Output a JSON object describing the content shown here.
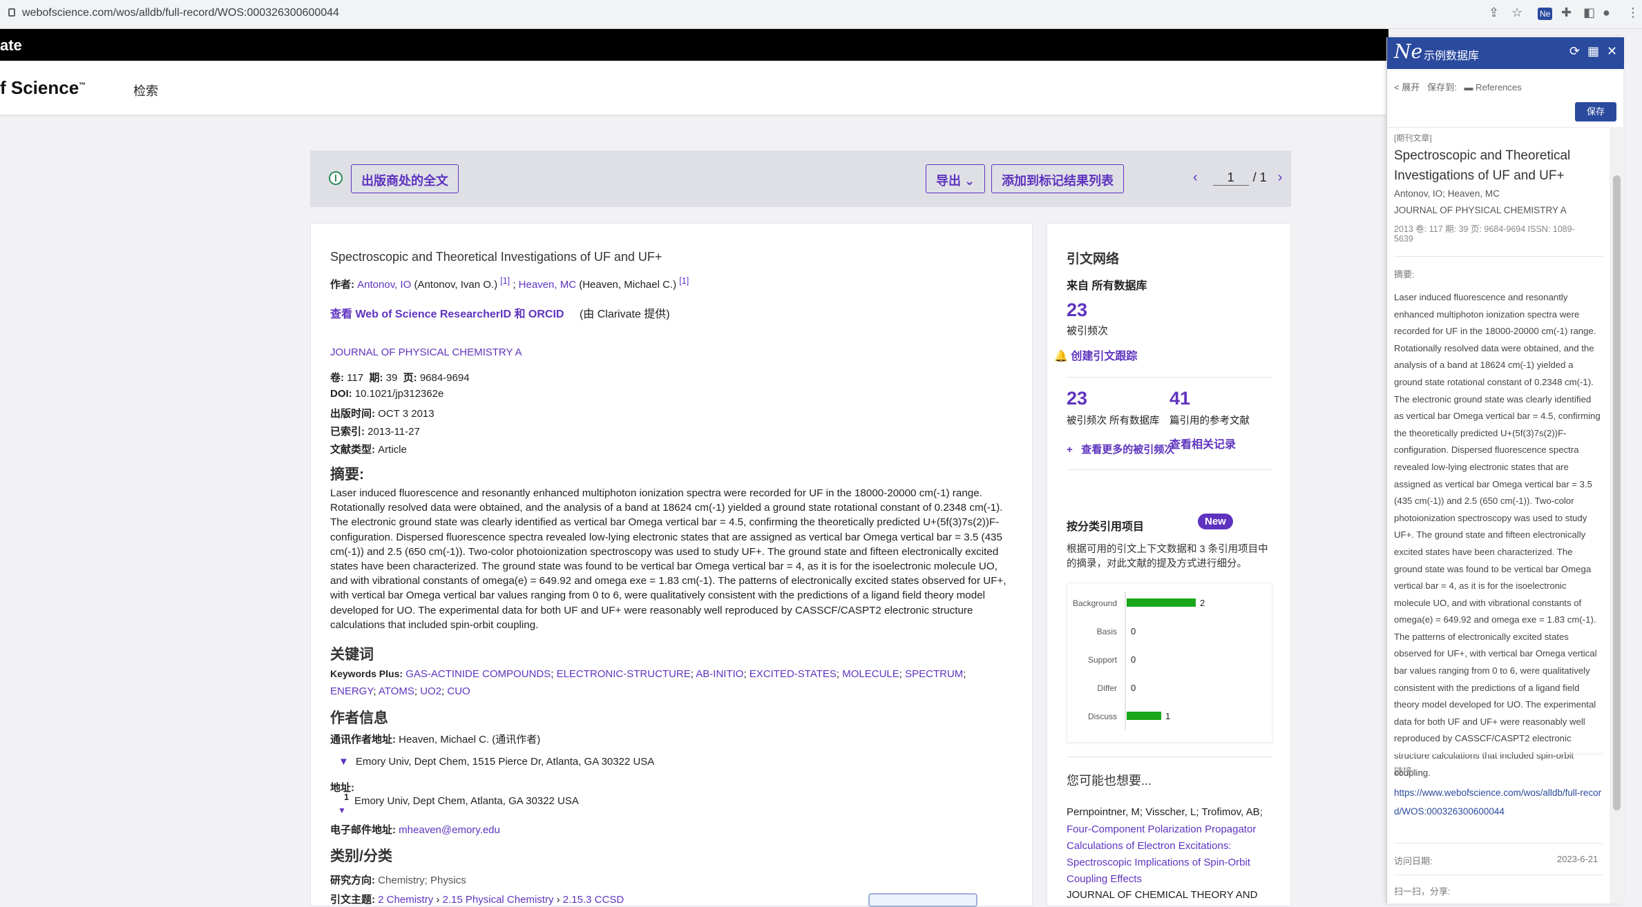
{
  "browser": {
    "url": "webofscience.com/wos/alldb/full-record/WOS:000326300600044"
  },
  "brand": {
    "clarivate_fragment": "ate",
    "logo_fragment": "f Science",
    "logo_tm": "™",
    "nav_search": "检索"
  },
  "toolbar": {
    "full_text": "出版商处的全文",
    "export": "导出",
    "export_caret": "⌄",
    "add_to_marked": "添加到标记结果列表",
    "page_current": "1",
    "page_total": "/ 1",
    "prev": "‹",
    "next": "›"
  },
  "record": {
    "title": "Spectroscopic and Theoretical Investigations of UF and UF+",
    "authors_label": "作者:",
    "author1": "Antonov, IO",
    "author1_full": "(Antonov, Ivan O.)",
    "author1_ref": "[1]",
    "author_sep": ";",
    "author2": "Heaven, MC",
    "author2_full": "(Heaven, Michael C.)",
    "author2_ref": "[1]",
    "researcher_link": "查看 Web of Science ResearcherID 和 ORCID",
    "researcher_by": "(由 Clarivate 提供)",
    "journal": "JOURNAL OF PHYSICAL CHEMISTRY A",
    "vol_label": "卷:",
    "vol": "117",
    "issue_label": "期:",
    "issue": "39",
    "page_label": "页:",
    "pages": "9684-9694",
    "doi_label": "DOI:",
    "doi": "10.1021/jp312362e",
    "pub_label": "出版时间:",
    "pub_date": "OCT 3 2013",
    "indexed_label": "已索引:",
    "indexed": "2013-11-27",
    "doctype_label": "文献类型:",
    "doctype": "Article",
    "abstract_heading": "摘要:",
    "abstract": "Laser induced fluorescence and resonantly enhanced multiphoton ionization spectra were recorded for UF in the 18000-20000 cm(-1) range. Rotationally resolved data were obtained, and the analysis of a band at 18624 cm(-1) yielded a ground state rotational constant of 0.2348 cm(-1). The electronic ground state was clearly identified as vertical bar Omega vertical bar = 4.5, confirming the theoretically predicted U+(5f(3)7s(2))F- configuration. Dispersed fluorescence spectra revealed low-lying electronic states that are assigned as vertical bar Omega vertical bar = 3.5 (435 cm(-1)) and 2.5 (650 cm(-1)). Two-color photoionization spectroscopy was used to study UF+. The ground state and fifteen electronically excited states have been characterized. The ground state was found to be vertical bar Omega vertical bar = 4, as it is for the isoelectronic molecule UO, and with vibrational constants of omega(e) = 649.92 and omega exe = 1.83 cm(-1). The patterns of electronically excited states observed for UF+, with vertical bar Omega vertical bar values ranging from 0 to 6, were qualitatively consistent with the predictions of a ligand field theory model developed for UO. The experimental data for both UF and UF+ were reasonably well reproduced by CASSCF/CASPT2 electronic structure calculations that included spin-orbit coupling.",
    "keywords_heading": "关键词",
    "keywords_plus_label": "Keywords Plus:",
    "keywords": [
      "GAS-ACTINIDE COMPOUNDS",
      "ELECTRONIC-STRUCTURE",
      "AB-INITIO",
      "EXCITED-STATES",
      "MOLECULE",
      "SPECTRUM",
      "ENERGY",
      "ATOMS",
      "UO2",
      "CUO"
    ],
    "author_info_heading": "作者信息",
    "corr_label": "通讯作者地址:",
    "corr_name": "Heaven, Michael C. (通讯作者)",
    "corr_address": "Emory Univ, Dept Chem, 1515 Pierce Dr, Atlanta, GA 30322 USA",
    "address_label": "地址:",
    "address_num": "1",
    "address": "Emory Univ, Dept Chem, Atlanta, GA 30322 USA",
    "email_label": "电子邮件地址:",
    "email": "mheaven@emory.edu",
    "category_heading": "类别/分类",
    "research_area_label": "研究方向:",
    "research_area": "Chemistry; Physics",
    "citation_topic_label": "引文主题:",
    "citation_topic_1": "2 Chemistry",
    "citation_topic_2": "2.15 Physical Chemistry",
    "citation_topic_3": "2.15.3 CCSD",
    "topic_sep": "›"
  },
  "citations": {
    "heading": "引文网络",
    "from_label": "来自 所有数据库",
    "times_cited": "23",
    "times_cited_label": "被引频次",
    "create_alert": "创建引文跟踪",
    "times_cited_all": "23",
    "times_cited_all_label": "被引频次 所有数据库",
    "cited_refs": "41",
    "cited_refs_label": "篇引用的参考文献",
    "more_times_cited": "查看更多的被引频次",
    "plus": "+",
    "related_records": "查看相关记录",
    "classification_heading": "按分类引用项目",
    "new_badge": "New",
    "classification_desc": "根据可用的引文上下文数据和 3 条引用项目中的摘录，对此文献的提及方式进行细分。",
    "also_like_heading": "您可能也想要...",
    "related_authors": "Pernpointner, M; Visscher, L; Trofimov, AB;",
    "related_title": "Four-Component Polarization Propagator Calculations of Electron Excitations: Spectroscopic Implications of Spin-Orbit Coupling Effects",
    "related_journal": "JOURNAL OF CHEMICAL THEORY AND"
  },
  "chart_data": {
    "type": "bar",
    "orientation": "horizontal",
    "categories": [
      "Background",
      "Basis",
      "Support",
      "Differ",
      "Discuss"
    ],
    "values": [
      2,
      0,
      0,
      0,
      1
    ],
    "xlim": [
      0,
      2
    ],
    "bar_color": "#1aa81a",
    "grid": false,
    "legend": "none"
  },
  "extension": {
    "logo": "Ne",
    "title": "示例数据库",
    "refresh_icon": "⟳",
    "grid_icon": "▦",
    "close_icon": "✕",
    "expand": "< 展开",
    "save_to": "保存到:",
    "folder": "References",
    "save_button": "保存",
    "item_type": "[期刊文章]",
    "item_title": "Spectroscopic and Theoretical Investigations of UF and UF+",
    "item_authors": "Antonov, IO; Heaven, MC",
    "item_journal": "JOURNAL OF PHYSICAL CHEMISTRY A",
    "item_meta_1": "2013  卷: 117   期: 39   页: 9684-9694   ISSN: 1089-",
    "item_meta_2": "5639",
    "abstract_label": "摘要:",
    "abstract": "Laser induced fluorescence and resonantly enhanced multiphoton ionization spectra were recorded for UF in the 18000-20000 cm(-1) range. Rotationally resolved data were obtained, and the analysis of a band at 18624 cm(-1) yielded a ground state rotational constant of 0.2348 cm(-1). The electronic ground state was clearly identified as vertical bar Omega vertical bar = 4.5, confirming the theoretically predicted U+(5f(3)7s(2))F- configuration. Dispersed fluorescence spectra revealed low-lying electronic states that are assigned as vertical bar Omega vertical bar = 3.5 (435 cm(-1)) and 2.5 (650 cm(-1)). Two-color photoionization spectroscopy was used to study UF+. The ground state and fifteen electronically excited states have been characterized. The ground state was found to be vertical bar Omega vertical bar = 4, as it is for the isoelectronic molecule UO, and with vibrational constants of omega(e) = 649.92 and omega exe = 1.83 cm(-1). The patterns of electronically excited states observed for UF+, with vertical bar Omega vertical bar values ranging from 0 to 6, were qualitatively consistent with the predictions of a ligand field theory model developed for UO. The experimental data for both UF and UF+ were reasonably well reproduced by CASSCF/CASPT2 electronic structure calculations that included spin-orbit coupling.",
    "link_label": "链接:",
    "link": "https://www.webofscience.com/wos/alldb/full-record/WOS:000326300600044",
    "access_label": "访问日期:",
    "access_date": "2023-6-21",
    "share_label": "扫一扫，分享:"
  },
  "colors": {
    "accent": "#5e33bf",
    "extension_header": "#2a4a9e",
    "chart_bar": "#1aa81a"
  }
}
